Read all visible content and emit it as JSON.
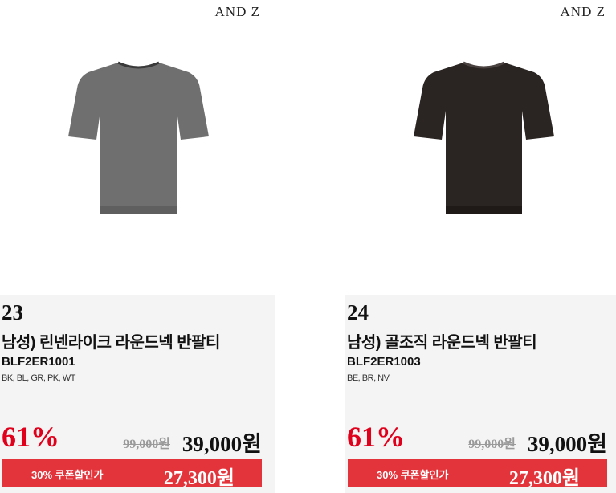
{
  "products": [
    {
      "brand": "AND Z",
      "rank": "23",
      "name": "남성) 린넨라이크 라운드넥 반팔티",
      "code": "BLF2ER1001",
      "colors": "BK, BL, GR, PK, WT",
      "discount_rate": "61%",
      "original_price": "99,000원",
      "sale_price": "39,000원",
      "coupon_label": "30% 쿠폰할인가",
      "coupon_price": "27,300원",
      "shirt_color": "#6f6f6f"
    },
    {
      "brand": "AND Z",
      "rank": "24",
      "name": "남성) 골조직 라운드넥 반팔티",
      "code": "BLF2ER1003",
      "colors": "BE, BR, NV",
      "discount_rate": "61%",
      "original_price": "99,000원",
      "sale_price": "39,000원",
      "coupon_label": "30% 쿠폰할인가",
      "coupon_price": "27,300원",
      "shirt_color": "#2a2422"
    }
  ],
  "colors": {
    "accent_red": "#e0001b",
    "coupon_bg": "#e2343a"
  }
}
